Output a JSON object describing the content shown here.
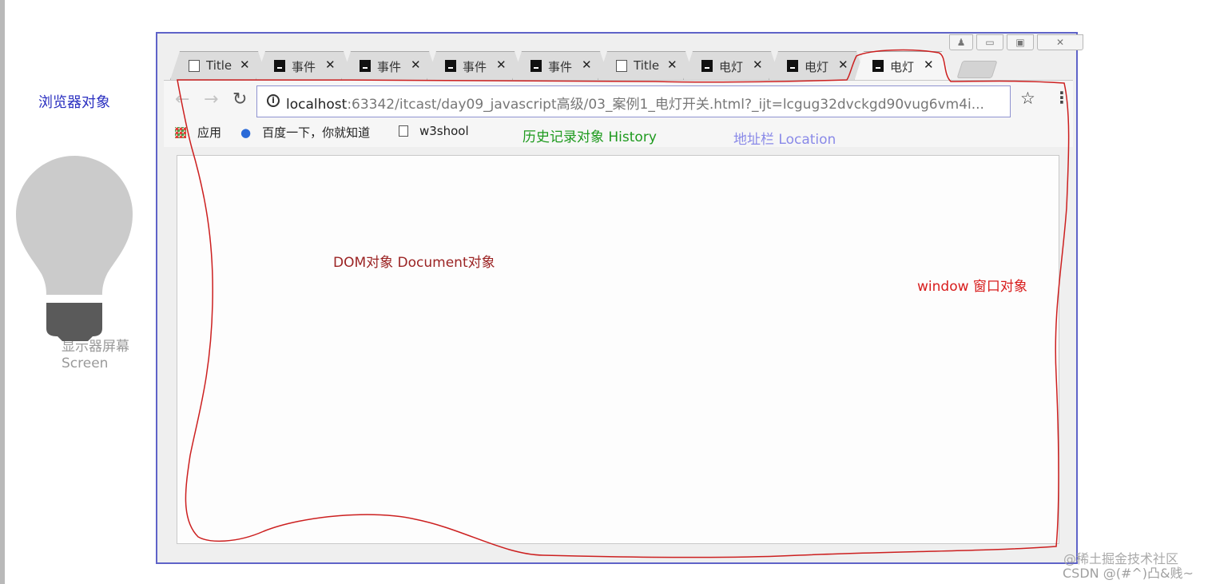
{
  "annotations": {
    "browser_object": "浏览器对象",
    "screen_line1": "显示器屏幕",
    "screen_line2": "Screen",
    "history": "历史记录对象 History",
    "location": "地址栏 Location",
    "dom": "DOM对象 Document对象",
    "window": "window 窗口对象"
  },
  "annotation_colors": {
    "browser_object": "#2a2fc0",
    "screen": "#9a9a9a",
    "history": "#1e9a1e",
    "location": "#8a8ae8",
    "dom": "#9b2323",
    "window": "#d81c1c"
  },
  "browser": {
    "tabs": [
      {
        "icon": "document-icon",
        "title": "Title"
      },
      {
        "icon": "intellij-icon",
        "title": "事件"
      },
      {
        "icon": "intellij-icon",
        "title": "事件"
      },
      {
        "icon": "intellij-icon",
        "title": "事件"
      },
      {
        "icon": "intellij-icon",
        "title": "事件"
      },
      {
        "icon": "document-icon",
        "title": "Title"
      },
      {
        "icon": "intellij-icon",
        "title": "电灯"
      },
      {
        "icon": "intellij-icon",
        "title": "电灯"
      },
      {
        "icon": "intellij-icon",
        "title": "电灯",
        "active": true
      }
    ],
    "tab_close_glyph": "✕",
    "url_host": "localhost",
    "url_path": ":63342/itcast/day09_javascript高级/03_案例1_电灯开关.html?_ijt=lcgug32dvckgd90vug6vm4i...",
    "bookmarks": [
      {
        "icon": "apps-icon",
        "label": "应用"
      },
      {
        "icon": "paw-icon",
        "label": "百度一下，你就知道"
      },
      {
        "icon": "page-icon",
        "label": "w3shool"
      }
    ]
  },
  "watermark": {
    "line1": "@稀土掘金技术社区",
    "line2": "CSDN @(#^)凸&贱~"
  }
}
